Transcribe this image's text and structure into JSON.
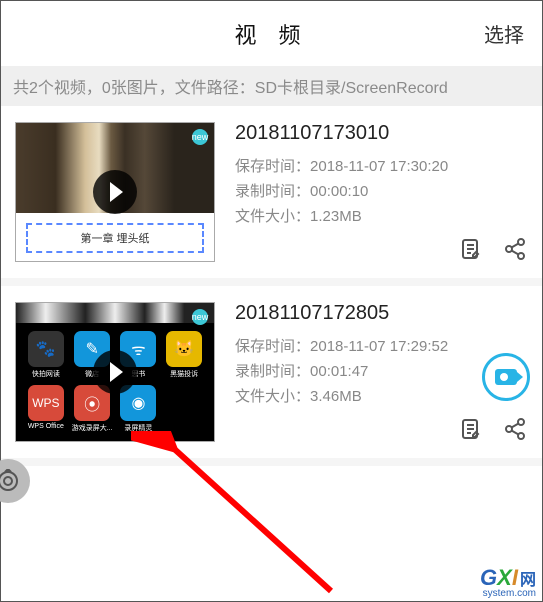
{
  "header": {
    "title": "视 频",
    "select": "选择"
  },
  "summary": "共2个视频，0张图片，文件路径：SD卡根目录/ScreenRecord",
  "videos": [
    {
      "title": "20181107173010",
      "saveTimeLabel": "保存时间：",
      "saveTime": "2018-11-07 17:30:20",
      "recTimeLabel": "录制时间：",
      "recTime": "00:00:10",
      "sizeLabel": "文件大小：",
      "size": "1.23MB",
      "thumbText": "第一章 埋头纸",
      "badge": "new"
    },
    {
      "title": "20181107172805",
      "saveTimeLabel": "保存时间：",
      "saveTime": "2018-11-07 17:29:52",
      "recTimeLabel": "录制时间：",
      "recTime": "00:01:47",
      "sizeLabel": "文件大小：",
      "size": "3.46MB",
      "badge": "new"
    }
  ],
  "apps": [
    {
      "name": "快拍网读",
      "color": "#333"
    },
    {
      "name": "微店",
      "color": "#1296db"
    },
    {
      "name": "思书",
      "color": "#1296db"
    },
    {
      "name": "黑猫投诉",
      "color": "#e6b800"
    },
    {
      "name": "WPS Office",
      "color": "#d74a3a"
    },
    {
      "name": "游戏录屏大...",
      "color": "#d74a3a"
    },
    {
      "name": "录屏精灵",
      "color": "#1296db"
    }
  ],
  "watermark": {
    "brand1": "G",
    "brand2": "X",
    "brand3": "I",
    "net": "网",
    "url": "system.com"
  }
}
